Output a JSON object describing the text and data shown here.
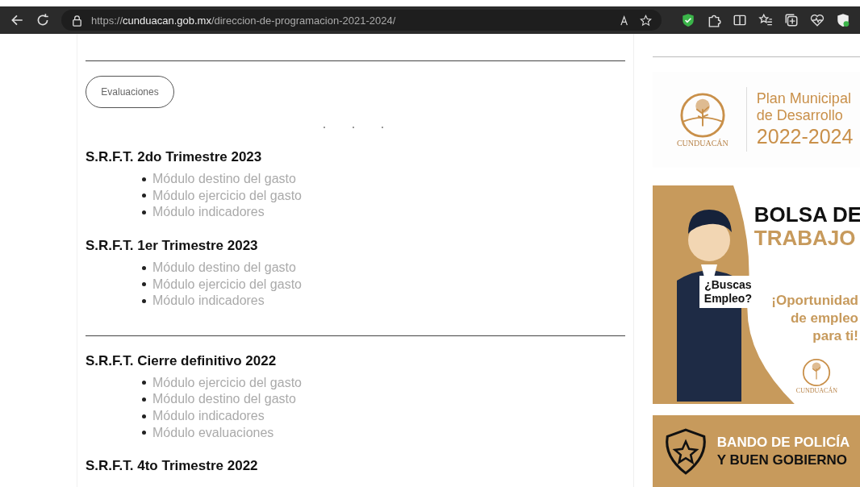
{
  "browser": {
    "url": "https://**cunduacan.gob.mx**/direccion-de-programacion-2021-2024/"
  },
  "content": {
    "button": "Evaluaciones",
    "sections": [
      {
        "title": "S.R.F.T. 2do Trimestre 2023",
        "divider_before": false,
        "items": [
          "Módulo destino del gasto",
          "Módulo ejercicio del gasto",
          "Módulo indicadores"
        ]
      },
      {
        "title": "S.R.F.T. 1er Trimestre 2023",
        "divider_before": false,
        "items": [
          "Módulo destino del gasto",
          "Módulo ejercicio del gasto",
          "Módulo indicadores"
        ]
      },
      {
        "title": "S.R.F.T. Cierre definitivo 2022",
        "divider_before": true,
        "items": [
          "Módulo ejercicio del gasto",
          "Módulo destino del gasto",
          "Módulo indicadores",
          "Módulo evaluaciones"
        ]
      },
      {
        "title": "S.R.F.T. 4to Trimestre 2022",
        "divider_before": false
      }
    ]
  },
  "sidebar": {
    "plan_banner": {
      "logo_text": "CUNDUACÁN",
      "lines": [
        "Plan Municipal",
        "de Desarrollo",
        "2022-2024"
      ]
    },
    "job_banner": {
      "headline": [
        "BOLSA DE",
        "TRABAJO"
      ],
      "sign": [
        "¿Buscas",
        "Empleo?"
      ],
      "tagline": [
        "¡Oportunidad",
        "de empleo",
        "para ti!"
      ],
      "logo_text": "CUNDUACÁN"
    },
    "police_banner": {
      "lines": [
        "BANDO DE POLICÍA",
        "Y BUEN GOBIERNO"
      ]
    }
  }
}
